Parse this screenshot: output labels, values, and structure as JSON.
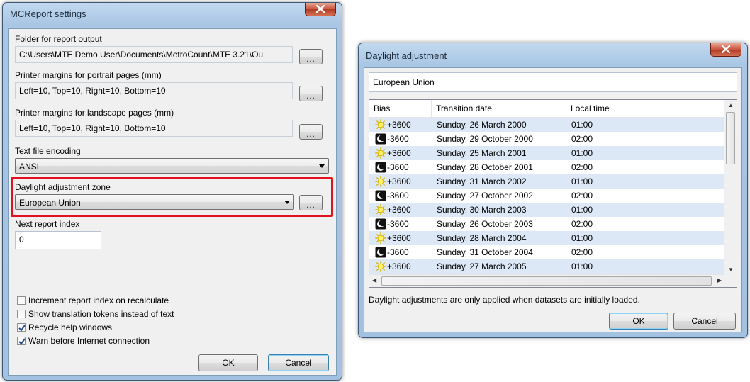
{
  "settings": {
    "title": "MCReport settings",
    "folder_label": "Folder for report output",
    "folder_value": "C:\\Users\\MTE Demo User\\Documents\\MetroCount\\MTE 3.21\\Ou",
    "portrait_label": "Printer margins for portrait pages (mm)",
    "portrait_value": "Left=10, Top=10, Right=10, Bottom=10",
    "landscape_label": "Printer margins for landscape pages (mm)",
    "landscape_value": "Left=10, Top=10, Right=10, Bottom=10",
    "encoding_label": "Text file encoding",
    "encoding_value": "ANSI",
    "daylight_label": "Daylight adjustment zone",
    "daylight_value": "European Union",
    "index_label": "Next report index",
    "index_value": "0",
    "browse_label": "...",
    "checkboxes": [
      {
        "label": "Increment report index on recalculate",
        "checked": false
      },
      {
        "label": "Show translation tokens instead of text",
        "checked": false
      },
      {
        "label": "Recycle help windows",
        "checked": true
      },
      {
        "label": "Warn before Internet connection",
        "checked": true
      }
    ],
    "ok_label": "OK",
    "cancel_label": "Cancel"
  },
  "daylight": {
    "title": "Daylight adjustment",
    "zone_value": "European Union",
    "columns": [
      "Bias",
      "Transition date",
      "Local time"
    ],
    "rows": [
      {
        "icon": "sun-icon",
        "bias": "+3600",
        "date": "Sunday, 26 March 2000",
        "time": "01:00"
      },
      {
        "icon": "moon-icon",
        "bias": "-3600",
        "date": "Sunday, 29 October 2000",
        "time": "02:00"
      },
      {
        "icon": "sun-icon",
        "bias": "+3600",
        "date": "Sunday, 25 March 2001",
        "time": "01:00"
      },
      {
        "icon": "moon-icon",
        "bias": "-3600",
        "date": "Sunday, 28 October 2001",
        "time": "02:00"
      },
      {
        "icon": "sun-icon",
        "bias": "+3600",
        "date": "Sunday, 31 March 2002",
        "time": "01:00"
      },
      {
        "icon": "moon-icon",
        "bias": "-3600",
        "date": "Sunday, 27 October 2002",
        "time": "02:00"
      },
      {
        "icon": "sun-icon",
        "bias": "+3600",
        "date": "Sunday, 30 March 2003",
        "time": "01:00"
      },
      {
        "icon": "moon-icon",
        "bias": "-3600",
        "date": "Sunday, 26 October 2003",
        "time": "02:00"
      },
      {
        "icon": "sun-icon",
        "bias": "+3600",
        "date": "Sunday, 28 March 2004",
        "time": "01:00"
      },
      {
        "icon": "moon-icon",
        "bias": "-3600",
        "date": "Sunday, 31 October 2004",
        "time": "02:00"
      },
      {
        "icon": "sun-icon",
        "bias": "+3600",
        "date": "Sunday, 27 March 2005",
        "time": "01:00"
      }
    ],
    "note": "Daylight adjustments are only applied when datasets are initially loaded.",
    "ok_label": "OK",
    "cancel_label": "Cancel"
  },
  "colors": {
    "highlight": "#e2111d",
    "row_alt": "#dce8f6",
    "title_accent": "#a9c6e4"
  }
}
